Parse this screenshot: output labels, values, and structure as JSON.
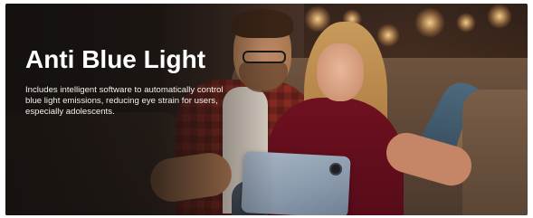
{
  "banner": {
    "title": "Anti Blue Light",
    "description": "Includes intelligent software to automatically control blue light emissions, reducing eye strain for users, especially adolescents."
  },
  "colors": {
    "title_text": "#ffffff",
    "body_text": "#f3f0ec",
    "background_dark": "#1f1a17"
  }
}
